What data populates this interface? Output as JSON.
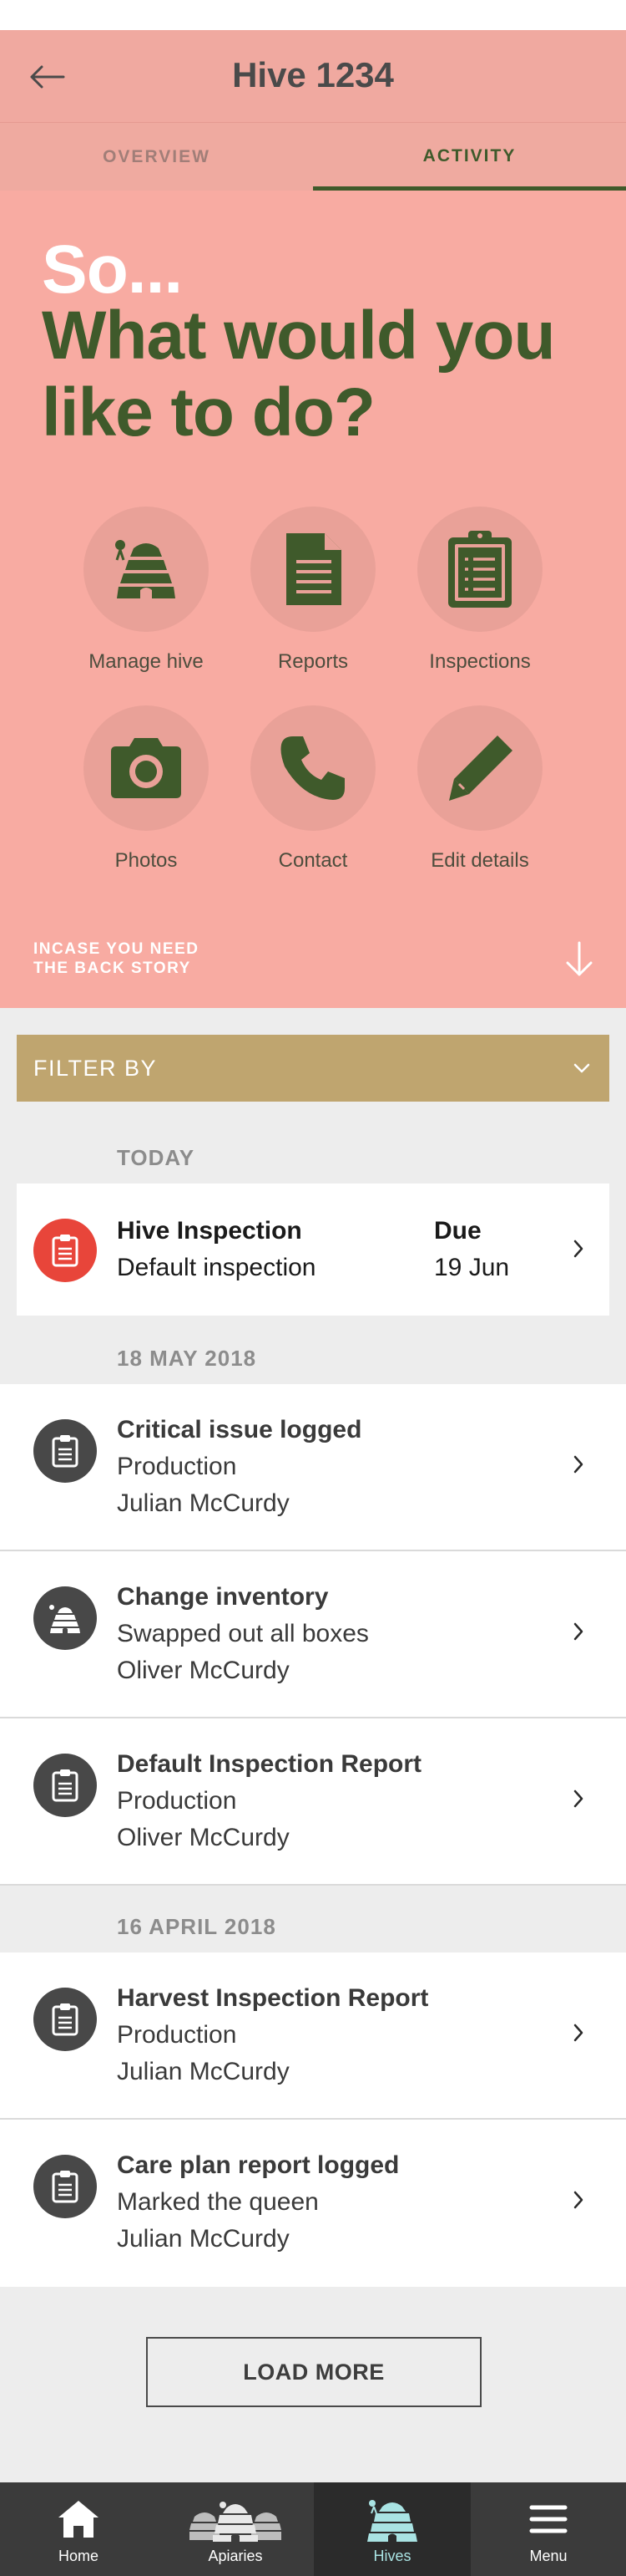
{
  "header": {
    "title": "Hive 1234"
  },
  "tabs": [
    {
      "label": "OVERVIEW",
      "active": false
    },
    {
      "label": "ACTIVITY",
      "active": true
    }
  ],
  "hero": {
    "line1": "So...",
    "line2": "What would you like to do?",
    "actions": [
      {
        "label": "Manage hive",
        "icon": "beehive-icon"
      },
      {
        "label": "Reports",
        "icon": "document-icon"
      },
      {
        "label": "Inspections",
        "icon": "clipboard-icon"
      },
      {
        "label": "Photos",
        "icon": "camera-icon"
      },
      {
        "label": "Contact",
        "icon": "phone-icon"
      },
      {
        "label": "Edit details",
        "icon": "pencil-icon"
      }
    ],
    "backstory": "INCASE YOU NEED\nTHE BACK STORY"
  },
  "filter": {
    "label": "FILTER BY"
  },
  "today": {
    "heading": "TODAY",
    "item": {
      "title": "Hive Inspection",
      "subtitle": "Default inspection",
      "due_label": "Due",
      "due_date": "19 Jun"
    }
  },
  "sections": [
    {
      "heading": "18 MAY 2018",
      "items": [
        {
          "title": "Critical issue logged",
          "subtitle": "Production",
          "author": "Julian McCurdy",
          "icon": "clipboard-icon"
        },
        {
          "title": "Change inventory",
          "subtitle": "Swapped out all boxes",
          "author": "Oliver McCurdy",
          "icon": "beehive-icon"
        },
        {
          "title": "Default Inspection Report",
          "subtitle": "Production",
          "author": "Oliver McCurdy",
          "icon": "clipboard-icon"
        }
      ]
    },
    {
      "heading": "16 APRIL 2018",
      "items": [
        {
          "title": "Harvest Inspection Report",
          "subtitle": "Production",
          "author": "Julian McCurdy",
          "icon": "clipboard-icon"
        },
        {
          "title": "Care plan report logged",
          "subtitle": "Marked the queen",
          "author": "Julian McCurdy",
          "icon": "clipboard-icon"
        }
      ]
    }
  ],
  "load_more": "LOAD MORE",
  "nav": [
    {
      "label": "Home",
      "icon": "home-icon",
      "active": false
    },
    {
      "label": "Apiaries",
      "icon": "apiaries-icon",
      "active": false
    },
    {
      "label": "Hives",
      "icon": "hive-icon",
      "active": true
    },
    {
      "label": "Menu",
      "icon": "menu-icon",
      "active": false
    }
  ],
  "colors": {
    "header_pink": "#f0a9a0",
    "hero_pink": "#f8aba2",
    "brand_green": "#3f5a2b",
    "filter_gold": "#bfa56f",
    "alert_red": "#e8453a",
    "nav_dark": "#3b3b3b",
    "nav_active_text": "#a9e3e3"
  }
}
